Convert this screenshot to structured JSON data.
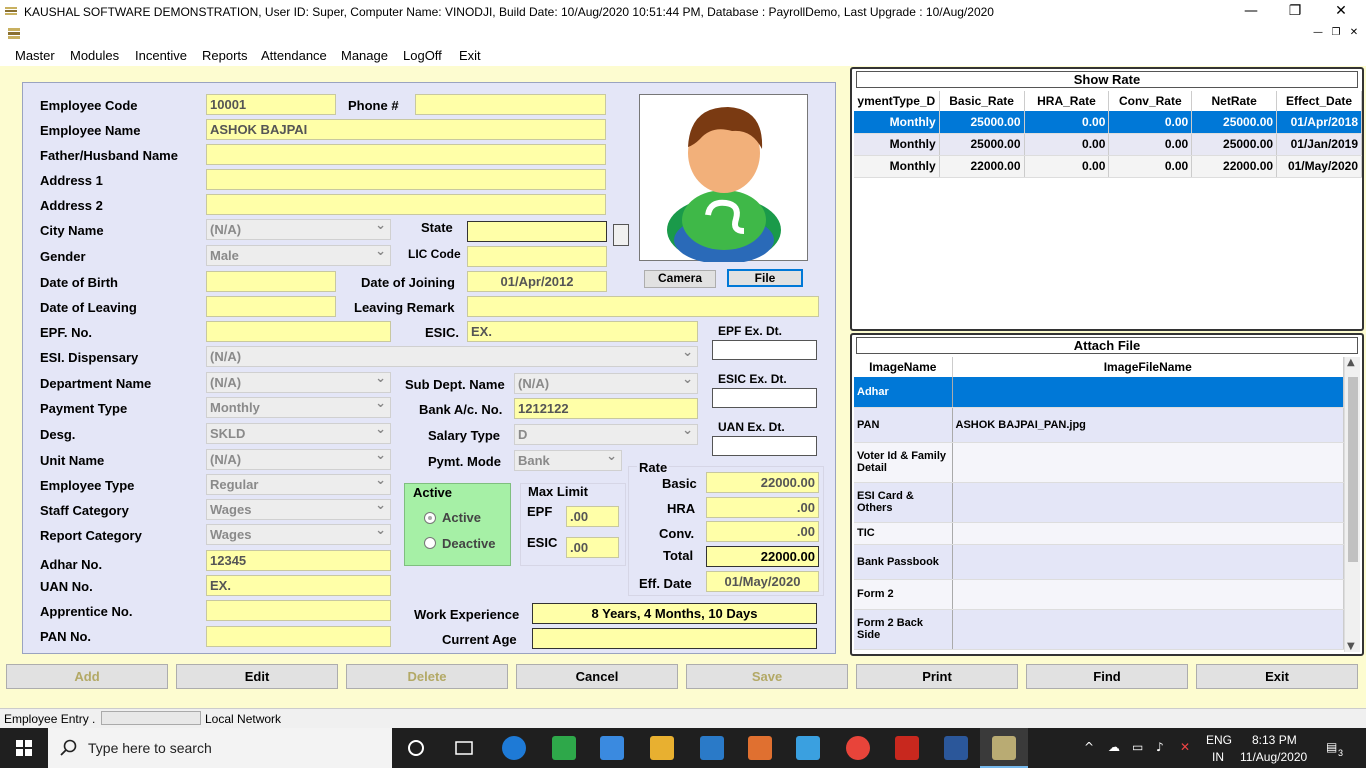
{
  "window": {
    "title": "KAUSHAL SOFTWARE DEMONSTRATION, User ID: Super, Computer Name: VINODJI, Build Date: 10/Aug/2020 10:51:44 PM, Database : PayrollDemo, Last Upgrade : 10/Aug/2020",
    "minimize": "—",
    "maximize": "❐",
    "close": "✕"
  },
  "menu": [
    "Master",
    "Modules",
    "Incentive",
    "Reports",
    "Attendance",
    "Manage",
    "LogOff",
    "Exit"
  ],
  "form": {
    "employee_code_label": "Employee Code",
    "employee_code": "10001",
    "phone_label": "Phone #",
    "phone": "",
    "employee_name_label": "Employee Name",
    "employee_name": "ASHOK BAJPAI",
    "father_label": "Father/Husband Name",
    "address1_label": "Address 1",
    "address2_label": "Address 2",
    "city_label": "City Name",
    "city": "(N/A)",
    "state_label": "State",
    "gender_label": "Gender",
    "gender": "Male",
    "lic_label": "LIC Code",
    "dob_label": "Date of Birth",
    "doj_label": "Date of Joining",
    "doj": "01/Apr/2012",
    "dol_label": "Date of Leaving",
    "leaving_remark_label": "Leaving Remark",
    "epf_label": "EPF. No.",
    "esic_label": "ESIC.",
    "esic": "EX.",
    "epf_ex_label": "EPF Ex. Dt.",
    "esi_disp_label": "ESI. Dispensary",
    "esi_disp": "(N/A)",
    "esic_ex_label": "ESIC Ex. Dt.",
    "dept_label": "Department Name",
    "dept": "(N/A)",
    "subdept_label": "Sub Dept. Name",
    "subdept": "(N/A)",
    "payment_label": "Payment Type",
    "payment": "Monthly",
    "bank_label": "Bank A/c. No.",
    "bank": "1212122",
    "uan_ex_label": "UAN Ex. Dt.",
    "desg_label": "Desg.",
    "desg": "SKLD",
    "salary_label": "Salary Type",
    "salary": "D",
    "unit_label": "Unit Name",
    "unit": "(N/A)",
    "pymt_label": "Pymt. Mode",
    "pymt": "Bank",
    "emptype_label": "Employee Type",
    "emptype": "Regular",
    "staff_label": "Staff Category",
    "staff": "Wages",
    "report_label": "Report Category",
    "report": "Wages",
    "adhar_label": "Adhar No.",
    "adhar": "12345",
    "uan_label": "UAN No.",
    "uan": "EX.",
    "apprentice_label": "Apprentice No.",
    "pan_label": "PAN No.",
    "work_exp_label": "Work Experience",
    "work_exp": "8 Years, 4 Months, 10 Days",
    "age_label": "Current Age",
    "age": ""
  },
  "photo": {
    "camera": "Camera",
    "file": "File"
  },
  "active": {
    "title": "Active",
    "opt1": "Active",
    "opt2": "Deactive",
    "selected": "Active"
  },
  "maxlimit": {
    "title": "Max Limit",
    "epf_label": "EPF",
    "epf": ".00",
    "esic_label": "ESIC",
    "esic": ".00"
  },
  "rate": {
    "title": "Rate",
    "basic_label": "Basic",
    "basic": "22000.00",
    "hra_label": "HRA",
    "hra": ".00",
    "conv_label": "Conv.",
    "conv": ".00",
    "total_label": "Total",
    "total": "22000.00",
    "eff_label": "Eff. Date",
    "eff": "01/May/2020"
  },
  "show_rate": {
    "title": "Show Rate",
    "headers": [
      "ymentType_D",
      "Basic_Rate",
      "HRA_Rate",
      "Conv_Rate",
      "NetRate",
      "Effect_Date"
    ],
    "rows": [
      [
        "Monthly",
        "25000.00",
        "0.00",
        "0.00",
        "25000.00",
        "01/Apr/2018"
      ],
      [
        "Monthly",
        "25000.00",
        "0.00",
        "0.00",
        "25000.00",
        "01/Jan/2019"
      ],
      [
        "Monthly",
        "22000.00",
        "0.00",
        "0.00",
        "22000.00",
        "01/May/2020"
      ]
    ]
  },
  "attach": {
    "title": "Attach File",
    "headers": [
      "ImageName",
      "ImageFileName"
    ],
    "rows": [
      [
        "Adhar",
        ""
      ],
      [
        "PAN",
        "ASHOK BAJPAI_PAN.jpg"
      ],
      [
        "Voter Id & Family Detail",
        ""
      ],
      [
        "ESI Card & Others",
        ""
      ],
      [
        "TIC",
        ""
      ],
      [
        "Bank Passbook",
        ""
      ],
      [
        "Form 2",
        ""
      ],
      [
        "Form 2 Back Side",
        ""
      ]
    ]
  },
  "actions": [
    "Add",
    "Edit",
    "Delete",
    "Cancel",
    "Save",
    "Print",
    "Find",
    "Exit"
  ],
  "status": {
    "left": "Employee Entry  .",
    "right": "Local Network"
  },
  "taskbar": {
    "search": "Type here to search",
    "lang1": "ENG",
    "lang2": "IN",
    "time": "8:13 PM",
    "date": "11/Aug/2020",
    "notif": "3"
  }
}
